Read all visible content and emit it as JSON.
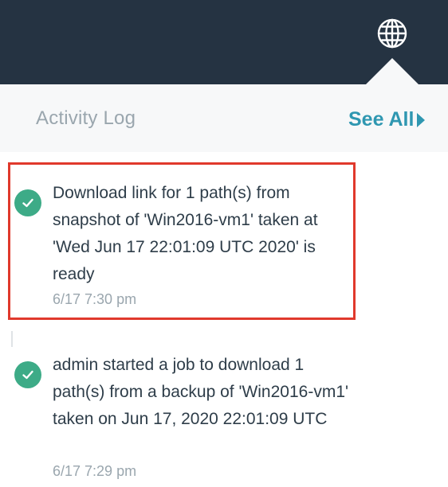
{
  "header": {
    "globe_icon": "globe-icon"
  },
  "activity_panel": {
    "title": "Activity Log",
    "see_all_label": "See All",
    "entries": [
      {
        "message": "Download link for 1 path(s) from snapshot of 'Win2016-vm1' taken at 'Wed Jun 17 22:01:09 UTC 2020' is ready",
        "time": "6/17 7:30 pm",
        "status_icon": "check-circle-icon",
        "highlighted": true
      },
      {
        "message": "admin started a job to download 1 path(s) from a backup of 'Win2016-vm1' taken on Jun 17, 2020 22:01:09 UTC",
        "time": "6/17 7:29 pm",
        "status_icon": "check-circle-icon",
        "highlighted": false
      }
    ]
  },
  "colors": {
    "topbar": "#253342",
    "accent": "#2f97b1",
    "success": "#3dab87",
    "highlight_border": "#e0392c",
    "muted_text": "#9aa6ae"
  }
}
